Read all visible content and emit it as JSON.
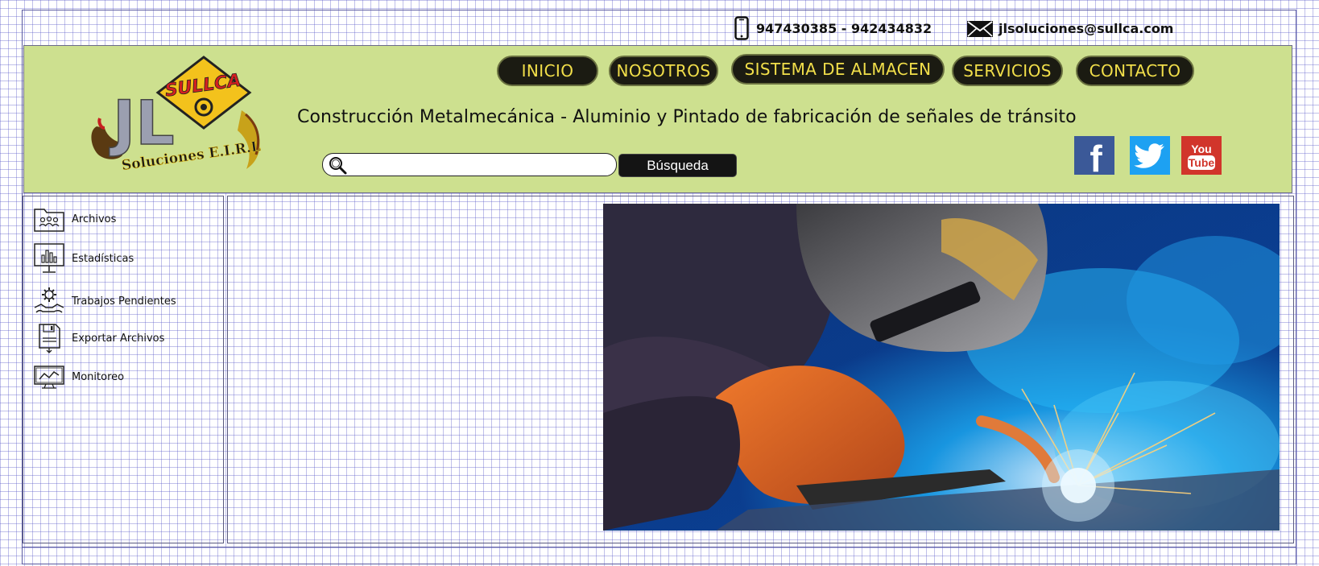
{
  "contact": {
    "phone": "947430385 - 942434832",
    "email": "jlsoluciones@sullca.com",
    "phone_icon": "mobile-phone-icon",
    "mail_icon": "envelope-icon"
  },
  "brand": {
    "logo_top": "SULLCA",
    "logo_letters": "JL",
    "logo_bottom": "Soluciones E.I.R.L"
  },
  "nav": {
    "inicio": "INICIO",
    "nosotros": "NOSOTROS",
    "almacen": "SISTEMA DE ALMACEN",
    "servicios": "SERVICIOS",
    "contacto": "CONTACTO"
  },
  "tagline": "Construcción Metalmecánica - Aluminio y Pintado de fabricación de señales de tránsito",
  "search": {
    "placeholder": "",
    "button_label": "Búsqueda"
  },
  "social": {
    "facebook": "f",
    "youtube_top": "You",
    "youtube_bottom": "Tube"
  },
  "sidebar": {
    "items": [
      {
        "label": "Archivos",
        "icon": "folder-users-icon"
      },
      {
        "label": "Estadísticas",
        "icon": "bar-chart-monitor-icon"
      },
      {
        "label": "Trabajos Pendientes",
        "icon": "gear-wrench-icon"
      },
      {
        "label": "Exportar Archivos",
        "icon": "floppy-disk-icon"
      },
      {
        "label": "Monitoreo",
        "icon": "monitor-line-chart-icon"
      }
    ]
  },
  "colors": {
    "header_bg": "#cde08f",
    "nav_bg": "#1b1b12",
    "nav_text": "#f2df4a",
    "facebook": "#3b5998",
    "twitter": "#1da1f2",
    "youtube": "#d1352b"
  }
}
